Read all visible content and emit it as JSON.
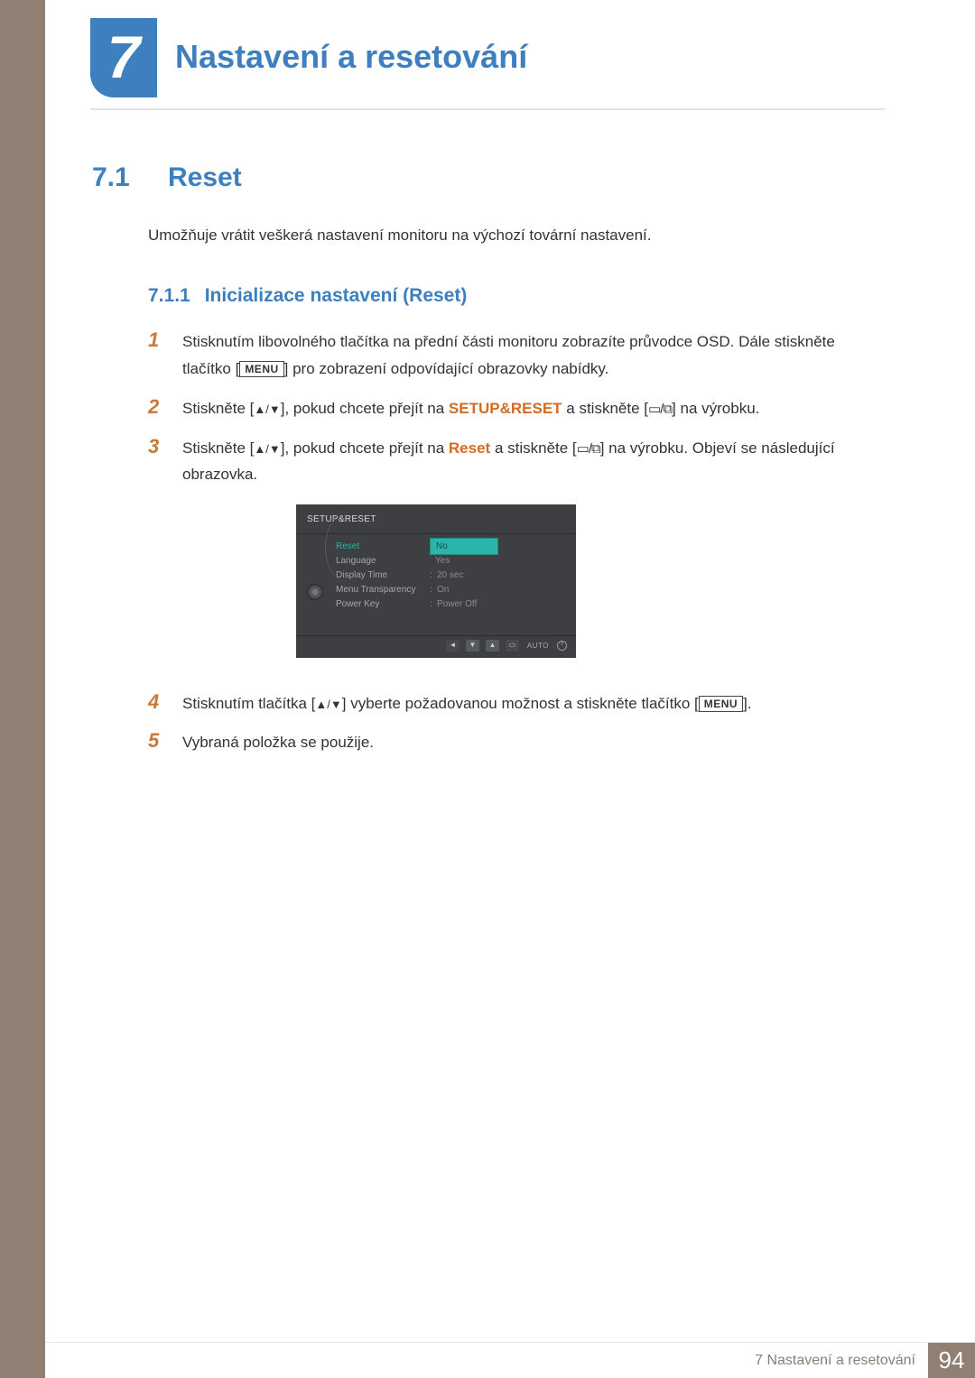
{
  "chapter": {
    "number": "7",
    "title": "Nastavení a resetování"
  },
  "section": {
    "number": "7.1",
    "title": "Reset"
  },
  "intro": "Umožňuje vrátit veškerá nastavení monitoru na výchozí tovární nastavení.",
  "subsection": {
    "number": "7.1.1",
    "title": "Inicializace nastavení (Reset)"
  },
  "kbd": {
    "menu": "MENU"
  },
  "steps": {
    "s1a": "Stisknutím libovolného tlačítka na přední části monitoru zobrazíte průvodce OSD. Dále stiskněte tlačítko [",
    "s1b": "] pro zobrazení odpovídající obrazovky nabídky.",
    "s2a": "Stiskněte [",
    "s2b": "], pokud chcete přejít na ",
    "s2_hl": "SETUP&RESET",
    "s2c": " a stiskněte [",
    "s2d": "] na výrobku.",
    "s3a": "Stiskněte [",
    "s3b": "], pokud chcete přejít na ",
    "s3_hl": "Reset",
    "s3c": " a stiskněte [",
    "s3d": "] na výrobku. Objeví se následující obrazovka.",
    "s4a": "Stisknutím tlačítka [",
    "s4b": "] vyberte požadovanou možnost a stiskněte tlačítko [",
    "s4c": "].",
    "s5": "Vybraná položka se použije."
  },
  "step_nums": {
    "n1": "1",
    "n2": "2",
    "n3": "3",
    "n4": "4",
    "n5": "5"
  },
  "osd": {
    "title": "SETUP&RESET",
    "items": {
      "reset": "Reset",
      "language": "Language",
      "display_time": "Display Time",
      "menu_transparency": "Menu Transparency",
      "power_key": "Power Key"
    },
    "values": {
      "no": "No",
      "yes": "Yes",
      "display_time": "20 sec",
      "menu_transparency": "On",
      "power_key": "Power Off"
    },
    "footer": {
      "auto": "AUTO"
    }
  },
  "footer": {
    "text": "7 Nastavení a resetování",
    "page": "94"
  }
}
